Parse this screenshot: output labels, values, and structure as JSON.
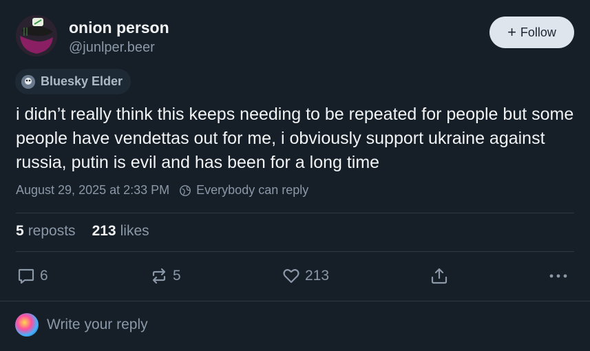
{
  "author": {
    "display_name": "onion person",
    "handle": "@junlper.beer"
  },
  "follow_button": {
    "label": "Follow"
  },
  "badge": {
    "label": "Bluesky Elder"
  },
  "post": {
    "text": "i didn’t really think this keeps needing to be repeated for people but some people have vendettas out for me, i obviously support ukraine against russia, putin is evil and has been for a long time",
    "timestamp": "August 29, 2025 at 2:33 PM",
    "reply_setting": "Everybody can reply"
  },
  "stats": {
    "reposts_count": "5",
    "reposts_label": "reposts",
    "likes_count": "213",
    "likes_label": "likes"
  },
  "actions": {
    "reply_count": "6",
    "repost_count": "5",
    "like_count": "213"
  },
  "reply_box": {
    "placeholder": "Write your reply"
  },
  "icons": [
    "reply-icon",
    "repost-icon",
    "like-icon",
    "share-icon",
    "more-icon",
    "globe-icon",
    "plus-icon"
  ]
}
